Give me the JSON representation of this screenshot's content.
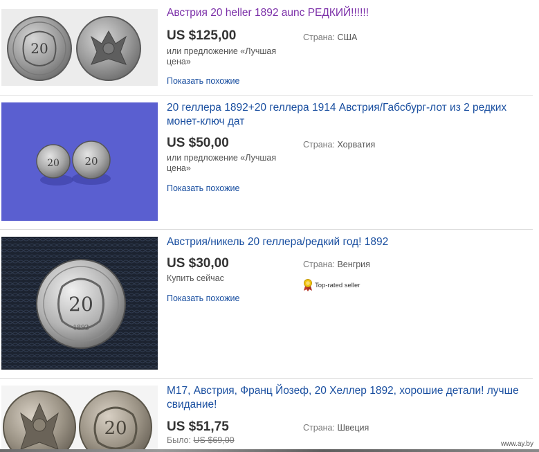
{
  "listings": [
    {
      "title": "Австрия 20 heller 1892 aunc РЕДКИЙ!!!!!!",
      "price": "US $125,00",
      "format": "или предложение «Лучшая цена»",
      "similar": "Показать похожие",
      "country_label": "Страна:",
      "country": "США",
      "visited": true
    },
    {
      "title": "20 геллера 1892+20 геллера 1914 Австрия/Габсбург-лот из 2 редких монет-ключ дат",
      "price": "US $50,00",
      "format": "или предложение «Лучшая цена»",
      "similar": "Показать похожие",
      "country_label": "Страна:",
      "country": "Хорватия"
    },
    {
      "title": "Австрия/никель 20 геллера/редкий год! 1892",
      "price": "US $30,00",
      "format": "Купить сейчас",
      "similar": "Показать похожие",
      "country_label": "Страна:",
      "country": "Венгрия",
      "badge": "Top-rated seller"
    },
    {
      "title": "М17, Австрия, Франц Йозеф, 20 Хеллер 1892, хорошие детали! лучше свидание!",
      "price": "US $51,75",
      "was_label": "Было:",
      "was_price": "US $69,00",
      "country_label": "Страна:",
      "country": "Швеция"
    }
  ],
  "coins": {
    "denomination": "20",
    "year": "1892"
  },
  "watermark": "www.ay.by",
  "colors": {
    "link": "#1a4fa0",
    "visited_link": "#7b2fa8",
    "price": "#333333",
    "photo2_background": "#5a5fd0",
    "photo3_background": "#1c2330"
  }
}
